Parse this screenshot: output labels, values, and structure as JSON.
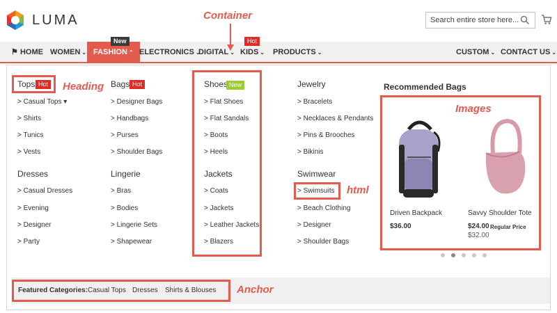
{
  "header": {
    "logo_text": "LUMA",
    "search_placeholder": "Search entire store here..."
  },
  "nav": {
    "home": "HOME",
    "women": "WOMEN",
    "fashion": "FASHION",
    "fashion_badge": "New",
    "electronics": "ELECTRONICS",
    "digital": "DIGITAL",
    "kids": "KIDS",
    "kids_badge": "Hot",
    "products": "PRODUCTS",
    "custom": "CUSTOM",
    "contact": "CONTACT US"
  },
  "menu": {
    "col1": {
      "heading1": "Tops",
      "heading1_badge": "Hot",
      "links1": [
        "> Casual Tops ▾",
        "> Shirts",
        "> Tunics",
        "> Vests"
      ],
      "heading2": "Dresses",
      "links2": [
        "> Casual Dresses",
        "> Evening",
        "> Designer",
        "> Party"
      ]
    },
    "col2": {
      "heading1": "Bags",
      "heading1_badge": "Hot",
      "links1": [
        "> Designer Bags",
        "> Handbags",
        "> Purses",
        "> Shoulder Bags"
      ],
      "heading2": "Lingerie",
      "links2": [
        "> Bras",
        "> Bodies",
        "> Lingerie Sets",
        "> Shapewear"
      ]
    },
    "col3": {
      "heading1": "Shoes",
      "heading1_badge": "New",
      "links1": [
        "> Flat Shoes",
        "> Flat Sandals",
        "> Boots",
        "> Heels"
      ],
      "heading2": "Jackets",
      "links2": [
        "> Coats",
        "> Jackets",
        "> Leather Jackets",
        "> Blazers"
      ]
    },
    "col4": {
      "heading1": "Jewelry",
      "links1": [
        "> Bracelets",
        "> Necklaces & Pendants",
        "> Pins & Brooches",
        "> Bikinis"
      ],
      "heading2": "Swimwear",
      "links2": [
        "> Swimsuits",
        "> Beach Clothing",
        "> Designer",
        "> Shoulder Bags"
      ]
    },
    "recommended": {
      "heading": "Recommended Bags",
      "products": [
        {
          "name": "Driven Backpack",
          "price": "$36.00"
        },
        {
          "name": "Savvy Shoulder Tote",
          "price": "$24.00",
          "regular_label": "Regular Price",
          "old_price": "$32.00"
        }
      ]
    },
    "featured": {
      "label": "Featured Categories:",
      "links": [
        "Casual Tops",
        "Dresses",
        "Shirts & Blouses"
      ]
    }
  },
  "annotations": {
    "container": "Container",
    "heading": "Heading",
    "images": "Images",
    "html": "html",
    "anchor": "Anchor"
  },
  "colors": {
    "accent": "#e25b4d",
    "hot": "#e02b27",
    "new_green": "#9acd32",
    "nav_bg": "#f0f0f0"
  }
}
